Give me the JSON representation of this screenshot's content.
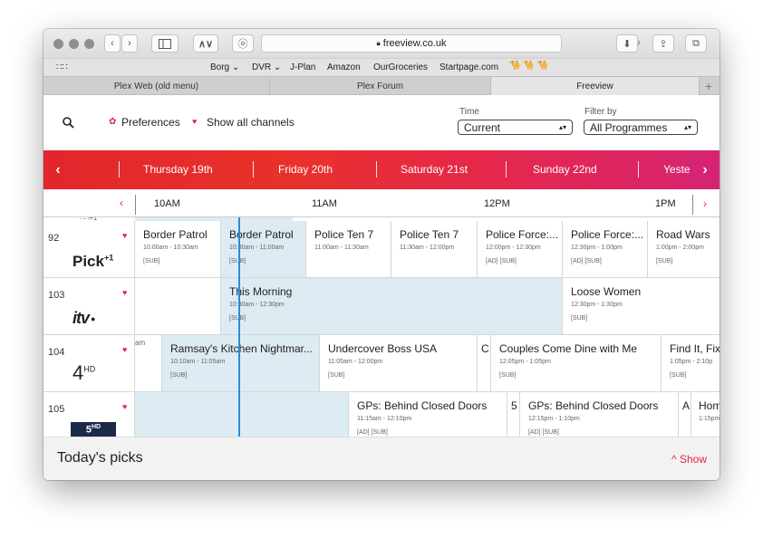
{
  "browser": {
    "url": "freeview.co.uk",
    "bookmarks": [
      "Borg ⌄",
      "DVR ⌄",
      "J-Plan",
      "Amazon",
      "OurGroceries",
      "Startpage.com"
    ],
    "camels": "🐪 🐪 🐪",
    "tabs": [
      {
        "label": "Plex Web (old menu)",
        "active": false
      },
      {
        "label": "Plex Forum",
        "active": false
      },
      {
        "label": "Freeview",
        "active": true
      }
    ]
  },
  "filters": {
    "preferences_label": "Preferences",
    "show_all_label": "Show all channels",
    "time_label": "Time",
    "time_value": "Current",
    "filter_label": "Filter by",
    "filter_value": "All Programmes"
  },
  "days": [
    "Thursday 19th",
    "Friday 20th",
    "Saturday 21st",
    "Sunday 22nd",
    "Yeste"
  ],
  "times": [
    "10AM",
    "11AM",
    "12PM",
    "1PM"
  ],
  "channels": [
    {
      "number": "92",
      "logo": "Pick",
      "logo_sup": "+1",
      "programmes": [
        {
          "title": "Border Patrol",
          "time": "10:00am - 10:30am",
          "flags": "[SUB]"
        },
        {
          "title": "Border Patrol",
          "time": "10:30am - 11:00am",
          "flags": "[SUB]"
        },
        {
          "title": "Police Ten 7",
          "time": "11:00am - 11:30am",
          "flags": ""
        },
        {
          "title": "Police Ten 7",
          "time": "11:30am - 12:00pm",
          "flags": ""
        },
        {
          "title": "Police Force:...",
          "time": "12:00pm - 12:30pm",
          "flags": "[AD] [SUB]"
        },
        {
          "title": "Police Force:...",
          "time": "12:30pm - 1:00pm",
          "flags": "[AD] [SUB]"
        },
        {
          "title": "Road Wars",
          "time": "1:00pm - 2:00pm",
          "flags": "[SUB]"
        }
      ]
    },
    {
      "number": "103",
      "logo": "itv",
      "programmes": [
        {
          "title": "",
          "time": "",
          "flags": ""
        },
        {
          "title": "This Morning",
          "time": "10:30am - 12:30pm",
          "flags": "[SUB]"
        },
        {
          "title": "Loose Women",
          "time": "12:30pm - 1:30pm",
          "flags": "[SUB]"
        },
        {
          "title": "",
          "time": "",
          "flags": ""
        }
      ]
    },
    {
      "number": "104",
      "logo": "4",
      "logo_sup": "HD",
      "programmes": [
        {
          "title": "",
          "time": "am",
          "flags": ""
        },
        {
          "title": "Ramsay's Kitchen Nightmar...",
          "time": "10:10am - 11:05am",
          "flags": "[SUB]"
        },
        {
          "title": "Undercover Boss USA",
          "time": "11:05am - 12:00pm",
          "flags": "[SUB]"
        },
        {
          "title": "C",
          "time": "",
          "flags": ""
        },
        {
          "title": "Couples Come Dine with Me",
          "time": "12:05pm - 1:05pm",
          "flags": "[SUB]"
        },
        {
          "title": "Find It, Fix",
          "time": "1:05pm - 2:10p",
          "flags": "[SUB]"
        }
      ]
    },
    {
      "number": "105",
      "logo": "5",
      "logo_sup": "HD",
      "programmes": [
        {
          "title": "",
          "time": "",
          "flags": ""
        },
        {
          "title": "GPs: Behind Closed Doors",
          "time": "11:15am - 12:10pm",
          "flags": "[AD] [SUB]"
        },
        {
          "title": "5",
          "time": "",
          "flags": ""
        },
        {
          "title": "GPs: Behind Closed Doors",
          "time": "12:15pm - 1:10pm",
          "flags": "[AD] [SUB]"
        },
        {
          "title": "A",
          "time": "",
          "flags": ""
        },
        {
          "title": "Hom",
          "time": "1:15pm",
          "flags": ""
        }
      ]
    }
  ],
  "picks": {
    "title": "Today's picks",
    "show": "^ Show"
  }
}
